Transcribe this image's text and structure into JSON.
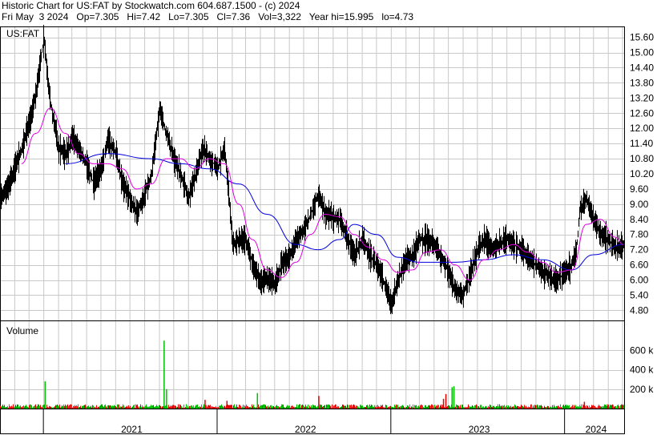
{
  "header": {
    "line1": "Historic Chart for US:FAT by Stockwatch.com 604.687.1500 - (c) 2024",
    "line2": "Fri May  3 2024   Op=7.305   Hi=7.42   Lo=7.305   Cl=7.36   Vol=3,322   Year hi=15.995   lo=4.73"
  },
  "chart_data": [
    {
      "type": "line",
      "title": "US:FAT",
      "symbol_label": "US:FAT",
      "series": [
        {
          "name": "",
          "role": "price",
          "color": "#000000"
        },
        {
          "name": "",
          "role": "short moving average",
          "color": "#e000e0"
        },
        {
          "name": "",
          "role": "long moving average",
          "color": "#0000e0"
        }
      ],
      "y_ticks": [
        "15.60",
        "15.00",
        "14.40",
        "13.80",
        "13.20",
        "12.60",
        "12.00",
        "11.40",
        "10.80",
        "10.20",
        "9.60",
        "9.00",
        "8.40",
        "7.80",
        "7.20",
        "6.60",
        "6.00",
        "5.40",
        "4.80"
      ],
      "ylim": [
        4.4,
        16.0
      ],
      "price_path": [
        [
          "2020-10-01",
          9.2
        ],
        [
          "2020-10-15",
          9.6
        ],
        [
          "2020-11-01",
          10.4
        ],
        [
          "2020-11-15",
          11.2
        ],
        [
          "2020-12-01",
          12.2
        ],
        [
          "2020-12-15",
          13.4
        ],
        [
          "2021-01-01",
          15.6
        ],
        [
          "2021-01-10",
          13.6
        ],
        [
          "2021-01-20",
          12.4
        ],
        [
          "2021-02-01",
          11.2
        ],
        [
          "2021-02-15",
          11.0
        ],
        [
          "2021-03-01",
          11.6
        ],
        [
          "2021-03-15",
          11.2
        ],
        [
          "2021-04-01",
          10.6
        ],
        [
          "2021-04-15",
          9.8
        ],
        [
          "2021-05-01",
          10.4
        ],
        [
          "2021-05-15",
          11.6
        ],
        [
          "2021-06-01",
          11.0
        ],
        [
          "2021-06-15",
          9.8
        ],
        [
          "2021-07-01",
          9.2
        ],
        [
          "2021-07-15",
          8.6
        ],
        [
          "2021-08-01",
          9.4
        ],
        [
          "2021-08-15",
          10.2
        ],
        [
          "2021-09-01",
          12.8
        ],
        [
          "2021-09-15",
          11.8
        ],
        [
          "2021-10-01",
          10.8
        ],
        [
          "2021-10-15",
          10.2
        ],
        [
          "2021-11-01",
          9.2
        ],
        [
          "2021-11-15",
          10.2
        ],
        [
          "2021-12-01",
          11.2
        ],
        [
          "2021-12-15",
          10.8
        ],
        [
          "2022-01-01",
          10.4
        ],
        [
          "2022-01-15",
          11.2
        ],
        [
          "2022-01-25",
          9.2
        ],
        [
          "2022-02-01",
          7.4
        ],
        [
          "2022-02-15",
          7.6
        ],
        [
          "2022-03-01",
          7.6
        ],
        [
          "2022-03-15",
          6.6
        ],
        [
          "2022-04-01",
          5.9
        ],
        [
          "2022-04-15",
          6.1
        ],
        [
          "2022-05-01",
          5.8
        ],
        [
          "2022-05-15",
          6.6
        ],
        [
          "2022-06-01",
          6.9
        ],
        [
          "2022-06-15",
          7.6
        ],
        [
          "2022-07-01",
          8.0
        ],
        [
          "2022-07-15",
          8.6
        ],
        [
          "2022-08-01",
          9.4
        ],
        [
          "2022-08-15",
          8.6
        ],
        [
          "2022-09-01",
          8.5
        ],
        [
          "2022-09-15",
          8.4
        ],
        [
          "2022-10-01",
          7.6
        ],
        [
          "2022-10-15",
          7.0
        ],
        [
          "2022-11-01",
          7.6
        ],
        [
          "2022-11-15",
          7.0
        ],
        [
          "2022-12-01",
          6.6
        ],
        [
          "2022-12-15",
          6.0
        ],
        [
          "2023-01-01",
          5.0
        ],
        [
          "2023-01-15",
          6.0
        ],
        [
          "2023-02-01",
          6.8
        ],
        [
          "2023-02-15",
          7.0
        ],
        [
          "2023-03-01",
          7.6
        ],
        [
          "2023-03-15",
          7.6
        ],
        [
          "2023-04-01",
          7.4
        ],
        [
          "2023-04-15",
          6.9
        ],
        [
          "2023-05-01",
          6.3
        ],
        [
          "2023-05-15",
          5.6
        ],
        [
          "2023-06-01",
          5.4
        ],
        [
          "2023-06-15",
          6.2
        ],
        [
          "2023-07-01",
          7.2
        ],
        [
          "2023-07-15",
          7.6
        ],
        [
          "2023-08-01",
          7.2
        ],
        [
          "2023-08-15",
          7.4
        ],
        [
          "2023-09-01",
          7.6
        ],
        [
          "2023-09-15",
          7.4
        ],
        [
          "2023-10-01",
          7.2
        ],
        [
          "2023-10-15",
          6.9
        ],
        [
          "2023-11-01",
          6.6
        ],
        [
          "2023-11-15",
          6.3
        ],
        [
          "2023-12-01",
          6.1
        ],
        [
          "2023-12-15",
          6.0
        ],
        [
          "2024-01-01",
          6.3
        ],
        [
          "2024-01-15",
          6.6
        ],
        [
          "2024-01-25",
          7.2
        ],
        [
          "2024-02-01",
          8.8
        ],
        [
          "2024-02-15",
          9.2
        ],
        [
          "2024-03-01",
          8.4
        ],
        [
          "2024-03-15",
          7.8
        ],
        [
          "2024-04-01",
          7.6
        ],
        [
          "2024-04-15",
          7.3
        ],
        [
          "2024-05-03",
          7.36
        ]
      ],
      "short_ma_path": [
        [
          "2020-11-15",
          10.6
        ],
        [
          "2020-12-15",
          11.8
        ],
        [
          "2021-01-15",
          12.8
        ],
        [
          "2021-02-15",
          11.8
        ],
        [
          "2021-03-15",
          11.0
        ],
        [
          "2021-04-15",
          10.6
        ],
        [
          "2021-05-15",
          10.6
        ],
        [
          "2021-06-15",
          10.4
        ],
        [
          "2021-07-15",
          9.6
        ],
        [
          "2021-08-15",
          9.8
        ],
        [
          "2021-09-15",
          10.8
        ],
        [
          "2021-10-15",
          10.8
        ],
        [
          "2021-11-15",
          10.4
        ],
        [
          "2021-12-15",
          10.8
        ],
        [
          "2022-01-15",
          10.6
        ],
        [
          "2022-02-15",
          9.0
        ],
        [
          "2022-03-15",
          7.6
        ],
        [
          "2022-04-15",
          6.4
        ],
        [
          "2022-05-15",
          6.1
        ],
        [
          "2022-06-15",
          6.7
        ],
        [
          "2022-07-15",
          7.8
        ],
        [
          "2022-08-15",
          8.6
        ],
        [
          "2022-09-15",
          8.5
        ],
        [
          "2022-10-15",
          7.8
        ],
        [
          "2022-11-15",
          7.3
        ],
        [
          "2022-12-15",
          6.8
        ],
        [
          "2023-01-15",
          6.3
        ],
        [
          "2023-02-15",
          6.4
        ],
        [
          "2023-03-15",
          7.1
        ],
        [
          "2023-04-15",
          7.2
        ],
        [
          "2023-05-15",
          6.6
        ],
        [
          "2023-06-15",
          6.0
        ],
        [
          "2023-07-15",
          6.8
        ],
        [
          "2023-08-15",
          7.2
        ],
        [
          "2023-09-15",
          7.4
        ],
        [
          "2023-10-15",
          7.1
        ],
        [
          "2023-11-15",
          6.7
        ],
        [
          "2023-12-15",
          6.3
        ],
        [
          "2024-01-15",
          6.4
        ],
        [
          "2024-02-15",
          8.2
        ],
        [
          "2024-03-15",
          8.4
        ],
        [
          "2024-04-15",
          7.7
        ],
        [
          "2024-05-03",
          7.4
        ]
      ],
      "long_ma_path": [
        [
          "2021-02-15",
          10.6
        ],
        [
          "2021-05-15",
          11.0
        ],
        [
          "2021-08-15",
          10.8
        ],
        [
          "2021-10-15",
          10.6
        ],
        [
          "2021-12-15",
          10.4
        ],
        [
          "2022-02-15",
          9.8
        ],
        [
          "2022-04-15",
          8.6
        ],
        [
          "2022-06-15",
          7.4
        ],
        [
          "2022-08-01",
          7.2
        ],
        [
          "2022-09-15",
          7.6
        ],
        [
          "2022-10-15",
          8.2
        ],
        [
          "2022-12-01",
          7.8
        ],
        [
          "2023-01-15",
          6.9
        ],
        [
          "2023-03-01",
          6.7
        ],
        [
          "2023-05-15",
          6.7
        ],
        [
          "2023-07-15",
          6.8
        ],
        [
          "2023-09-15",
          7.0
        ],
        [
          "2023-11-15",
          6.8
        ],
        [
          "2024-01-15",
          6.4
        ],
        [
          "2024-03-01",
          7.0
        ],
        [
          "2024-05-03",
          7.4
        ]
      ],
      "grid": true
    },
    {
      "type": "bar",
      "title": "Volume",
      "y_ticks": [
        "600 k",
        "400 k",
        "200 k"
      ],
      "ylim": [
        0,
        900000
      ],
      "up_color": "#00c000",
      "down_color": "#e00000",
      "spikes": [
        {
          "date": "2021-01-03",
          "value": 280000
        },
        {
          "date": "2021-09-10",
          "value": 700000
        },
        {
          "date": "2021-09-15",
          "value": 200000
        },
        {
          "date": "2022-03-25",
          "value": 160000
        },
        {
          "date": "2022-08-01",
          "value": 130000
        },
        {
          "date": "2023-04-25",
          "value": 150000
        },
        {
          "date": "2023-04-20",
          "value": 100000
        },
        {
          "date": "2023-05-08",
          "value": 220000
        },
        {
          "date": "2023-05-12",
          "value": 230000
        },
        {
          "date": "2021-12-05",
          "value": 90000
        },
        {
          "date": "2022-01-20",
          "value": 80000
        },
        {
          "date": "2024-02-10",
          "value": 70000
        }
      ],
      "baseline_level": 30000
    }
  ],
  "x_axis": {
    "years": [
      "2021",
      "2022",
      "2023",
      "2024"
    ]
  },
  "colors": {
    "grid": "#c8c8c8",
    "frame": "#000000",
    "background": "#ffffff"
  }
}
